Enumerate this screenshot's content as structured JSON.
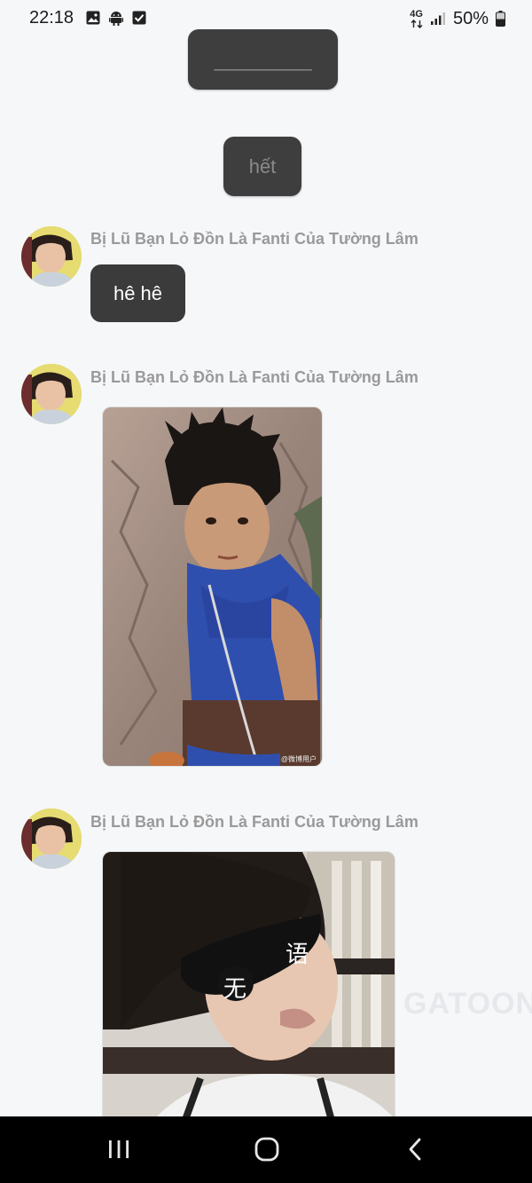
{
  "status_bar": {
    "time": "22:18",
    "left_icons": [
      "gallery-icon",
      "android-icon",
      "checkbox-icon"
    ],
    "network": "4G",
    "battery": "50%"
  },
  "own_messages": [
    {
      "text": "_________"
    },
    {
      "text": "hết"
    }
  ],
  "messages": [
    {
      "sender": "Bị Lũ Bạn Lỏ Đồn Là Fanti Của Tường Lâm",
      "type": "text",
      "text": "hê hê"
    },
    {
      "sender": "Bị Lũ Bạn Lỏ Đồn Là Fanti Của Tường Lâm",
      "type": "image",
      "watermark": "@微博用户"
    },
    {
      "sender": "Bị Lũ Bạn Lỏ Đồn Là Fanti Của Tường Lâm",
      "type": "image",
      "overlay_text": [
        "无",
        "语"
      ]
    }
  ],
  "background_watermark": "GATOON",
  "nav_bar": {
    "buttons": [
      "recent-apps-icon",
      "home-icon",
      "back-icon"
    ]
  },
  "colors": {
    "background": "#f6f7f9",
    "bubble": "#3b3b3b",
    "sender_name": "#9a9a9a"
  }
}
